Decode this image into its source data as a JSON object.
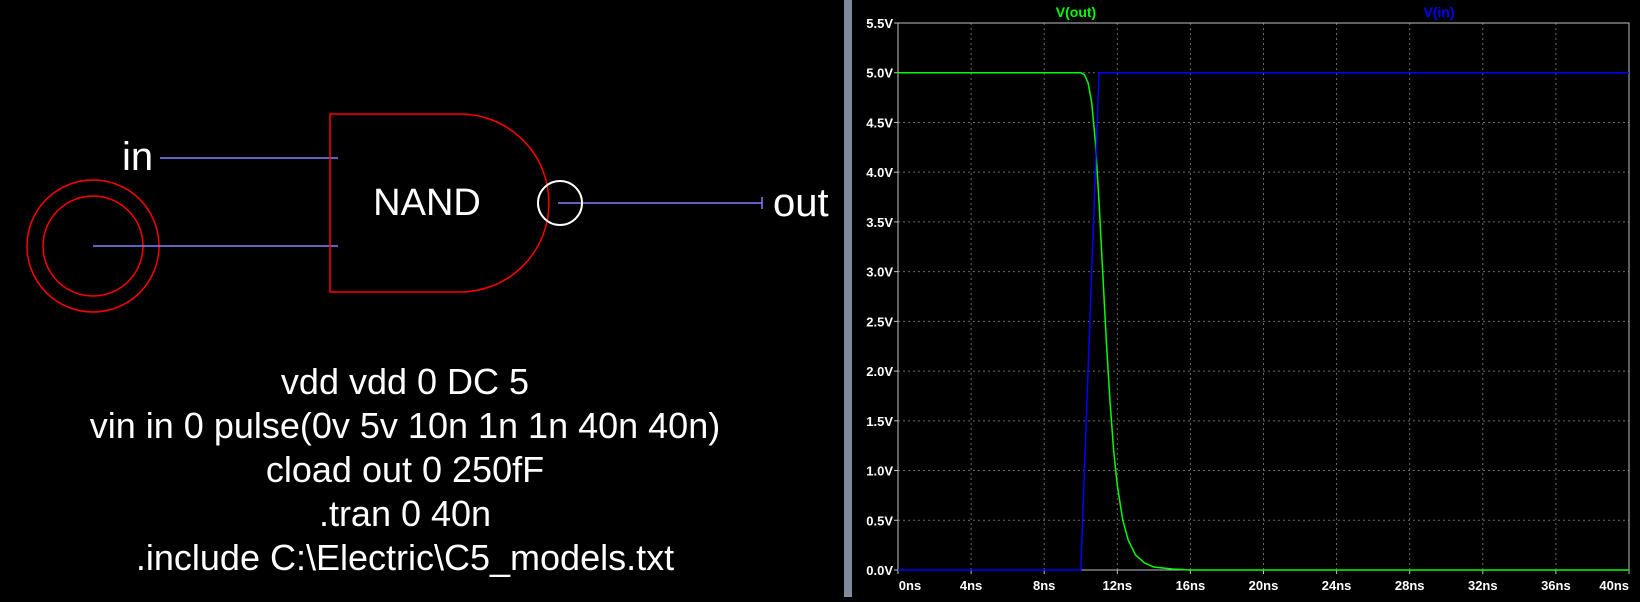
{
  "schematic": {
    "component_label": "NAND",
    "net_in": "in",
    "net_out": "out",
    "spice_lines": [
      "vdd vdd 0 DC 5",
      "vin in 0 pulse(0v 5v 10n 1n 1n 40n 40n)",
      "cload out 0 250fF",
      ".tran 0 40n",
      ".include C:\\Electric\\C5_models.txt"
    ],
    "colors": {
      "gate": "#ff0000",
      "wire": "#8080ff",
      "bubble": "#ffffff",
      "text": "#ffffff"
    }
  },
  "chart_data": {
    "type": "line",
    "xlabel": "",
    "ylabel": "",
    "x_unit": "ns",
    "y_unit": "V",
    "xlim": [
      0,
      40
    ],
    "ylim": [
      0,
      5.5
    ],
    "x_ticks": [
      "0ns",
      "4ns",
      "8ns",
      "12ns",
      "16ns",
      "20ns",
      "24ns",
      "28ns",
      "32ns",
      "36ns",
      "40ns"
    ],
    "y_ticks": [
      "0.0V",
      "0.5V",
      "1.0V",
      "1.5V",
      "2.0V",
      "2.5V",
      "3.0V",
      "3.5V",
      "4.0V",
      "4.5V",
      "5.0V",
      "5.5V"
    ],
    "grid": true,
    "background": "#000000",
    "series": [
      {
        "name": "V(out)",
        "color": "#00ff00",
        "x": [
          0,
          10.0,
          10.2,
          10.4,
          10.6,
          10.8,
          11.0,
          11.2,
          11.4,
          11.6,
          11.8,
          12.0,
          12.3,
          12.6,
          13.0,
          13.5,
          14.0,
          15.0,
          16.0,
          20.0,
          40.0
        ],
        "y": [
          5.0,
          5.0,
          4.98,
          4.9,
          4.7,
          4.3,
          3.7,
          3.0,
          2.3,
          1.7,
          1.2,
          0.85,
          0.5,
          0.3,
          0.15,
          0.07,
          0.03,
          0.01,
          0.0,
          0.0,
          0.0
        ]
      },
      {
        "name": "V(in)",
        "color": "#0000ff",
        "x": [
          0,
          10.0,
          11.0,
          40.0
        ],
        "y": [
          0.0,
          0.0,
          5.0,
          5.0
        ]
      }
    ]
  }
}
